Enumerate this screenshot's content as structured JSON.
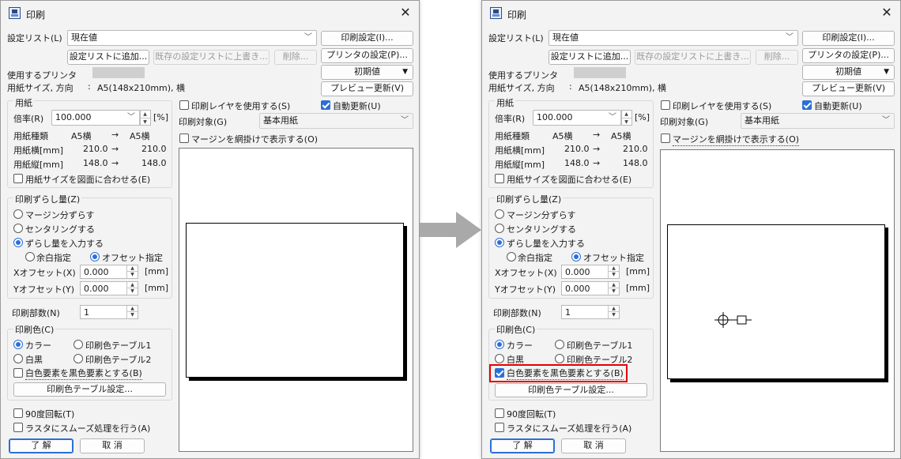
{
  "window_title": "印刷",
  "settings_list": {
    "label": "設定リスト(L)",
    "value": "現在値"
  },
  "buttons": {
    "print_settings": "印刷設定(I)...",
    "add_to_list": "設定リストに追加...",
    "overwrite": "既存の設定リストに上書き...",
    "delete": "削除...",
    "printer_settings": "プリンタの設定(P)...",
    "initial_value": "初期値",
    "preview_update": "プレビュー更新(V)",
    "color_table_settings": "印刷色テーブル設定...",
    "ok": "了 解",
    "cancel": "取 消"
  },
  "printer": {
    "label": "使用するプリンタ",
    "colon": ":"
  },
  "paper_size": {
    "label": "用紙サイズ, 方向",
    "colon": ":",
    "value": "A5(148x210mm), 横"
  },
  "paper_group": {
    "title": "用紙",
    "scale_label": "倍率(R)",
    "scale_value": "100.000",
    "scale_unit": "[%]",
    "type_label": "用紙種類",
    "type_from": "A5横",
    "arrow": "→",
    "type_to": "A5横",
    "width_label": "用紙横[mm]",
    "width_from": "210.0",
    "width_to": "210.0",
    "height_label": "用紙縦[mm]",
    "height_from": "148.0",
    "height_to": "148.0",
    "fit_label": "用紙サイズを図面に合わせる(E)"
  },
  "shift_group": {
    "title": "印刷ずらし量(Z)",
    "margin_shift": "マージン分ずらす",
    "centering": "センタリングする",
    "input_shift": "ずらし量を入力する",
    "blank": "余白指定",
    "offset": "オフセット指定",
    "x_label": "Xオフセット(X)",
    "x_value": "0.000",
    "y_label": "Yオフセット(Y)",
    "y_value": "0.000",
    "unit": "[mm]"
  },
  "copies": {
    "label": "印刷部数(N)",
    "value": "1"
  },
  "color_group": {
    "title": "印刷色(C)",
    "color": "カラー",
    "table1": "印刷色テーブル1",
    "mono": "白黒",
    "table2": "印刷色テーブル2",
    "white_to_black": "白色要素を黒色要素とする(B)"
  },
  "rotate90": "90度回転(T)",
  "smooth": "ラスタにスムーズ処理を行う(A)",
  "use_layer": "印刷レイヤを使用する(S)",
  "auto_update": "自動更新(U)",
  "print_target": {
    "label": "印刷対象(G)",
    "value": "基本用紙"
  },
  "margin_mesh": "マージンを網掛けで表示する(O)",
  "colors": {
    "accent": "#2b6fd6",
    "highlight": "#e60000",
    "arrow": "#a9a9a9"
  }
}
